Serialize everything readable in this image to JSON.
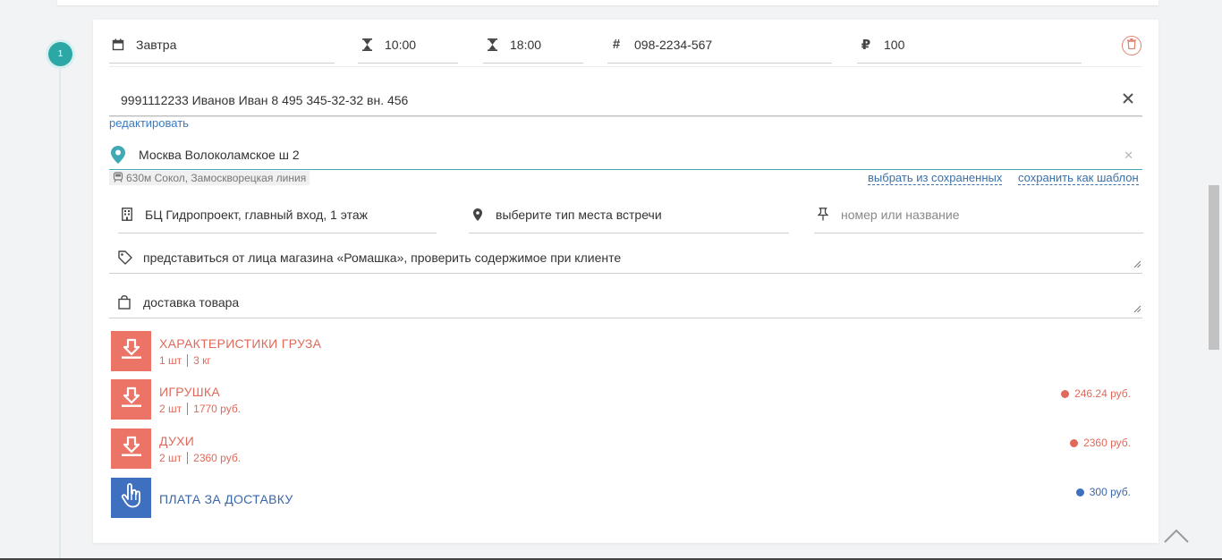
{
  "step": {
    "number": "1"
  },
  "form": {
    "date": "Завтра",
    "time_from": "10:00",
    "time_to": "18:00",
    "order_number": "098-2234-567",
    "amount": "100",
    "contact": "9991112233 Иванов Иван 8 495 345-32-32 вн. 456",
    "edit_label": "редактировать",
    "address": "Москва Волоколамское ш 2",
    "metro": "630м Сокол, Замоскворецкая линия",
    "choose_saved_label": "выбрать из сохраненных",
    "save_template_label": "сохранить как шаблон",
    "building": "БЦ Гидропроект, главный вход, 1 этаж",
    "meeting_type_placeholder": "выберите тип места встречи",
    "place_placeholder": "номер или название",
    "note": "представиться от лица магазина «Ромашка», проверить содержимое при клиенте",
    "description": "доставка товара"
  },
  "items": [
    {
      "title": "ХАРАКТЕРИСТИКИ ГРУЗА",
      "qty": "1 шт",
      "detail": "3 кг",
      "price": "",
      "icon": "download-icon",
      "color": "#ec7466"
    },
    {
      "title": "ИГРУШКА",
      "qty": "2 шт",
      "detail": "1770 руб.",
      "price": "246.24 руб.",
      "icon": "download-icon",
      "color": "#ec7466"
    },
    {
      "title": "ДУХИ",
      "qty": "2 шт",
      "detail": "2360 руб.",
      "price": "2360 руб.",
      "icon": "download-icon",
      "color": "#ec7466"
    },
    {
      "title": "ПЛАТА ЗА ДОСТАВКУ",
      "qty": "",
      "detail": "",
      "price": "300 руб.",
      "icon": "hand-pointer-icon",
      "color": "#3f6fbf"
    }
  ],
  "colors": {
    "accent": "#2ba7a5",
    "cargo": "#ec7466",
    "delivery": "#3f6fbf",
    "link": "#3a7bbf"
  }
}
